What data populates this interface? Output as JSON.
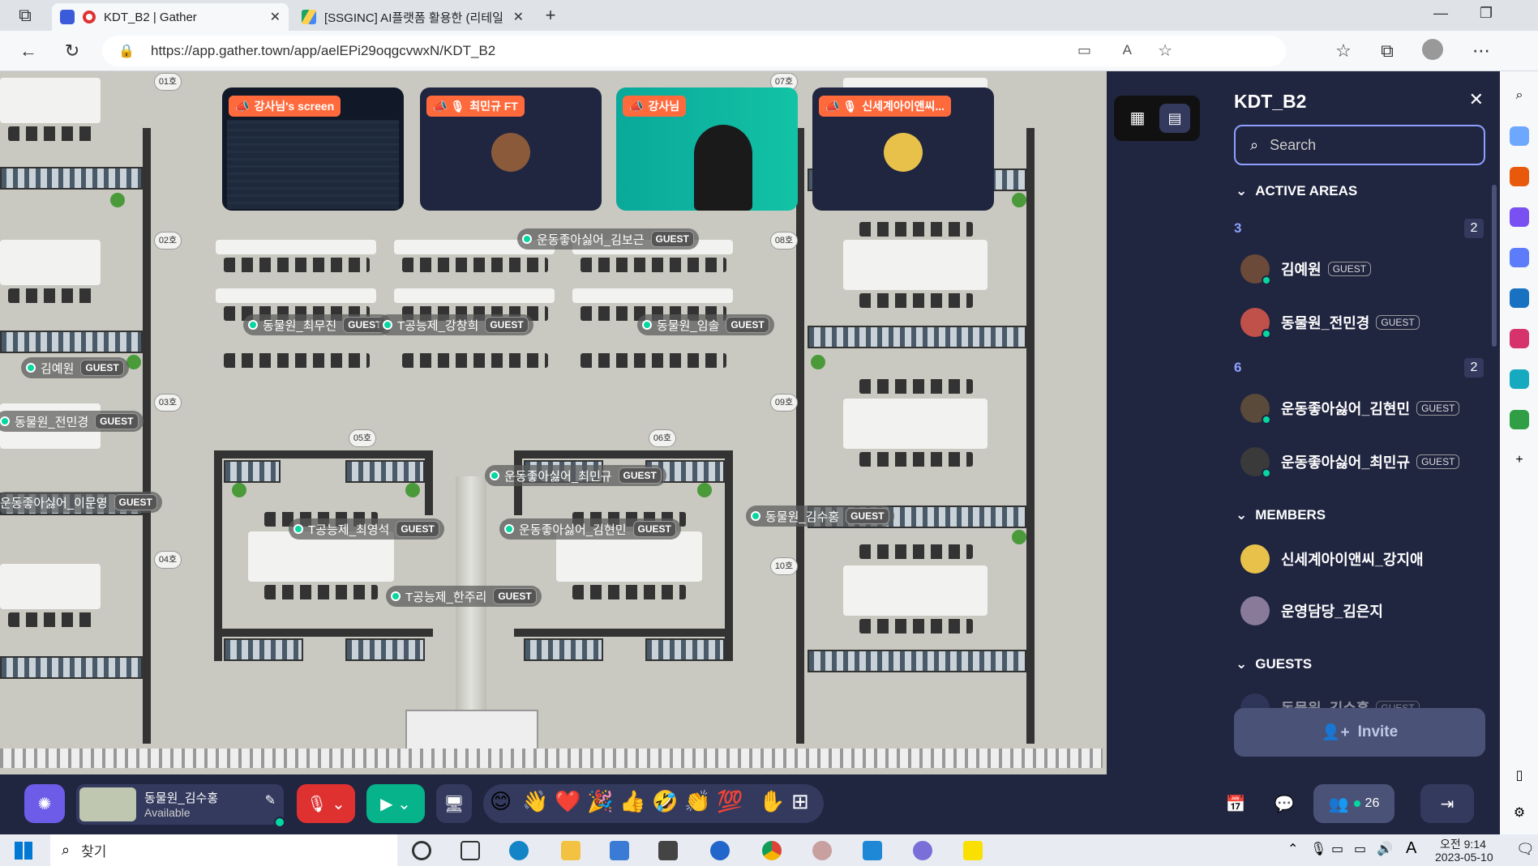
{
  "browser": {
    "tabs": [
      {
        "label": "KDT_B2 | Gather",
        "active": true
      },
      {
        "label": "[SSGINC] AI플랫폼 활용한 (리테일",
        "active": false
      }
    ],
    "url": "https://app.gather.town/app/aelEPi29oqgcvwxN/KDT_B2"
  },
  "video_tiles": [
    {
      "label": "강사님's screen"
    },
    {
      "label": "최민규 FT"
    },
    {
      "label": "강사님"
    },
    {
      "label": "신세계아이앤씨..."
    }
  ],
  "map": {
    "room_labels": [
      "01호",
      "02호",
      "03호",
      "04호",
      "05호",
      "06호",
      "07호",
      "08호",
      "09호",
      "10호"
    ],
    "guest_badge": "GUEST",
    "nametags": [
      {
        "name": "운동좋아싫어_김보근",
        "guest": true
      },
      {
        "name": "동물원_최무진",
        "guest": true
      },
      {
        "name": "T공능제_강창희",
        "guest": true
      },
      {
        "name": "동물원_임솔",
        "guest": true
      },
      {
        "name": "김예원",
        "guest": true
      },
      {
        "name": "동물원_전민경",
        "guest": true
      },
      {
        "name": "운동좋아싫어_최민규",
        "guest": true
      },
      {
        "name": "운동좋아싫어_이문영",
        "guest": true
      },
      {
        "name": "동물원_김수홍",
        "guest": true
      },
      {
        "name": "T공능제_최영석",
        "guest": true
      },
      {
        "name": "운동좋아싫어_김현민",
        "guest": true
      },
      {
        "name": "T공능제_한주리",
        "guest": true
      }
    ]
  },
  "panel": {
    "title": "KDT_B2",
    "search_placeholder": "Search",
    "active_areas_label": "ACTIVE AREAS",
    "areas": [
      {
        "number": "3",
        "count": "2",
        "people": [
          {
            "name": "김예원",
            "guest": "GUEST"
          },
          {
            "name": "동물원_전민경",
            "guest": "GUEST"
          }
        ]
      },
      {
        "number": "6",
        "count": "2",
        "people": [
          {
            "name": "운동좋아싫어_김현민",
            "guest": "GUEST"
          },
          {
            "name": "운동좋아싫어_최민규",
            "guest": "GUEST"
          }
        ]
      }
    ],
    "members_label": "MEMBERS",
    "members": [
      {
        "name": "신세계아이앤씨_강지애"
      },
      {
        "name": "운영담당_김은지"
      }
    ],
    "guests_label": "GUESTS",
    "guests_partial": {
      "name": "동물원_김수홍",
      "guest": "GUEST"
    },
    "invite_label": "Invite"
  },
  "toolbar": {
    "user_name": "동물원_김수홍",
    "user_status": "Available",
    "emojis": [
      "😊",
      "👋",
      "❤️",
      "🎉",
      "👍",
      "🤣",
      "👏",
      "💯"
    ],
    "participants_count": "26"
  },
  "taskbar": {
    "search_placeholder": "찾기",
    "time": "오전 9:14",
    "date": "2023-05-10",
    "ime": "A"
  },
  "colors": {
    "gather_dark": "#202540",
    "accent_orange": "#ff6a3d",
    "online_green": "#06d6a0",
    "button_bg": "#333a5e"
  }
}
